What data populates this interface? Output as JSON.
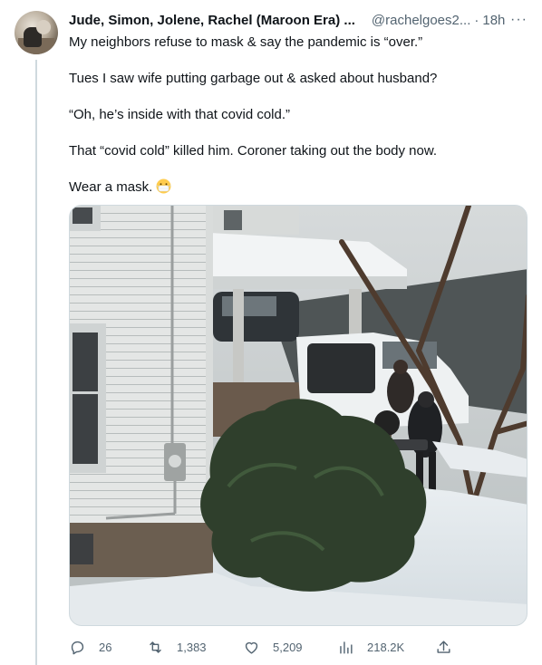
{
  "tweet": {
    "display_name": "Jude, Simon, Jolene, Rachel (Maroon Era) ...",
    "handle": "@rachelgoes2...",
    "separator": "·",
    "time": "18h",
    "more_label": "···",
    "lines": [
      "My neighbors refuse to mask & say the pandemic is “over.”",
      "Tues I saw wife putting garbage out & asked about husband?",
      "“Oh, he’s inside with that covid cold.”",
      "That “covid cold” killed him. Coroner taking out the body now.",
      "Wear a mask."
    ],
    "emoji_icon": "face-with-medical-mask-emoji"
  },
  "actions": {
    "replies": "26",
    "retweets": "1,383",
    "likes": "5,209",
    "views": "218.2K"
  },
  "colors": {
    "text": "#0f1419",
    "secondary": "#536471",
    "border": "#cfd9de"
  }
}
